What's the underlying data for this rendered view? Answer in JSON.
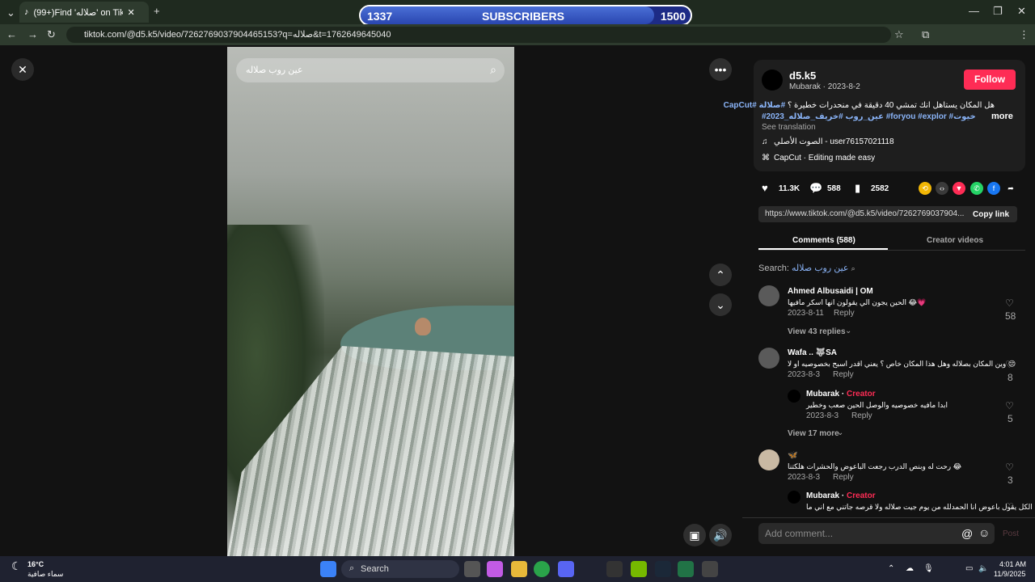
{
  "browser": {
    "tab_title": "(99+)Find 'صلاله' on TikTok:",
    "url": "tiktok.com/@d5.k5/video/7262769037904465153?q=صلاله&t=1762649645040",
    "subscriber_counter": {
      "current": "1337",
      "label": "SUBSCRIBERS",
      "goal": "1500",
      "progress": 0.89
    }
  },
  "video": {
    "search_query": "عين روب صلاله",
    "search_icon": "search-icon"
  },
  "post": {
    "username": "d5.k5",
    "nickname_date": "Mubarak · 2023-8-2",
    "follow_label": "Follow",
    "caption_line1": "هل المكان يستاهل انك تمشي 40 دقيقة في منحدرات خطيرة ؟",
    "caption_tags1": "#صلالة #CapCut",
    "caption_line2": "#2023_عين_روب #خريف_صلاله #foryou #explor #رخيوت ...",
    "more_label": "more",
    "see_translation": "See translation",
    "music": "الصوت الأصلي - user76157021118",
    "capcut": "CapCut · Editing made easy",
    "likes": "11.3K",
    "comments": "588",
    "saves": "2582",
    "share_url": "https://www.tiktok.com/@d5.k5/video/7262769037904...",
    "copy_link": "Copy link"
  },
  "tabs": {
    "comments": "Comments (588)",
    "creator_videos": "Creator videos"
  },
  "search_hint": {
    "label": "Search:",
    "query": "عين روب صلاله"
  },
  "comments": [
    {
      "name": "Ahmed Albusaidi | OM",
      "text": "الحين يجون الي يقولون انها اسكر مافيها 😂💗",
      "date": "2023-8-11",
      "reply": "Reply",
      "likes": "58",
      "view_more": "View 43 replies"
    },
    {
      "name": "Wafa .. 🐺SA",
      "text": "وين المكان بصلاله وهل هذا المكان خاص ؟ يعني اقدر اسبح بخصوصيه او لا 😔",
      "date": "2023-8-3",
      "reply": "Reply",
      "likes": "8",
      "view_more": "View 17 more"
    },
    {
      "name": "Mubarak",
      "creator": "Creator",
      "text": "ابدا مافيه خصوصيه والوصل الحين صعب وخطير",
      "date": "2023-8-3",
      "reply": "Reply",
      "likes": "5"
    },
    {
      "name": "🦋",
      "text": "رحت له وبنص الدرب رجعت الباعوض والحشرات هلكتنا 😂",
      "date": "2023-8-3",
      "reply": "Reply",
      "likes": "3"
    },
    {
      "name": "Mubarak",
      "creator": "Creator",
      "text": "الكل يقول باعوض انا الحمدلله من يوم جيت صلاله ولا قرصه جاتني مع اني ما"
    }
  ],
  "comment_box": {
    "placeholder": "Add comment...",
    "post": "Post"
  },
  "taskbar": {
    "weather_temp": "16°C",
    "weather_desc": "سماء صافية",
    "search": "Search",
    "time": "4:01 AM",
    "date": "11/9/2025"
  }
}
